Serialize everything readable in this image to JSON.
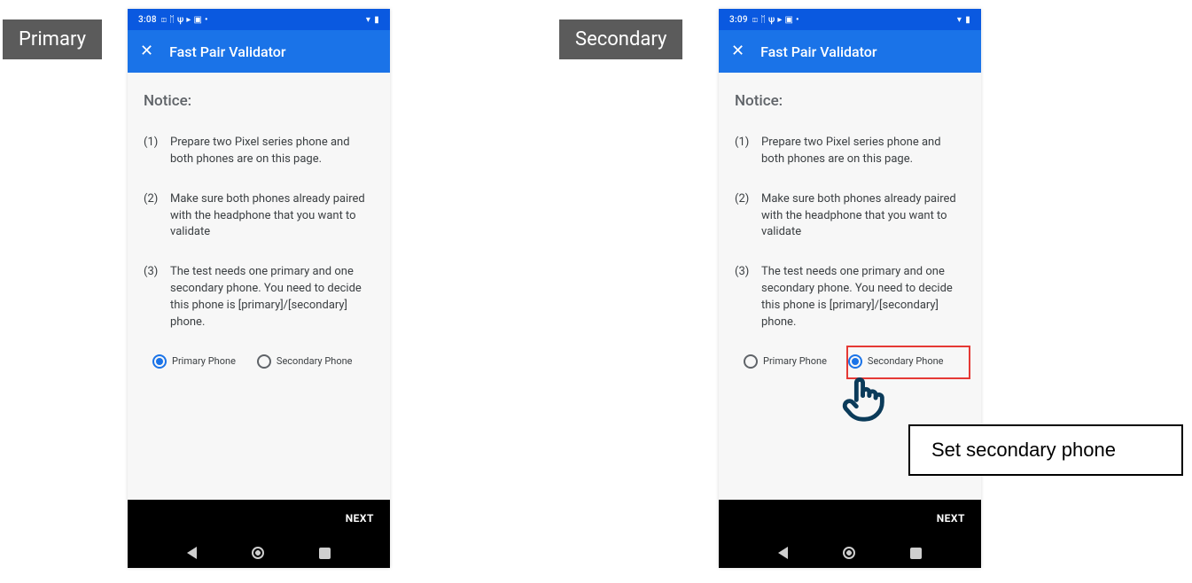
{
  "tags": {
    "primary": "Primary",
    "secondary": "Secondary"
  },
  "callout": "Set secondary phone",
  "phones": {
    "p1": {
      "time": "3:08",
      "status_icons": "◫ ᛖ ψ ▸ ▣ •",
      "app_title": "Fast Pair Validator",
      "notice": "Notice:",
      "step1_num": "(1)",
      "step1_txt": "Prepare two Pixel series phone and both phones are on this page.",
      "step2_num": "(2)",
      "step2_txt": "Make sure both phones already paired with the headphone that you want to validate",
      "step3_num": "(3)",
      "step3_txt": "The test needs one primary and one secondary phone. You need to decide this phone is [primary]/[secondary] phone.",
      "radio_primary": "Primary Phone",
      "radio_secondary": "Secondary Phone",
      "next": "NEXT"
    },
    "p2": {
      "time": "3:09",
      "status_icons": "◫ ᛖ ψ ▸ ▣ •",
      "app_title": "Fast Pair Validator",
      "notice": "Notice:",
      "step1_num": "(1)",
      "step1_txt": "Prepare two Pixel series phone and both phones are on this page.",
      "step2_num": "(2)",
      "step2_txt": "Make sure both phones already paired with the headphone that you want to validate",
      "step3_num": "(3)",
      "step3_txt": "The test needs one primary and one secondary phone. You need to decide this phone is [primary]/[secondary] phone.",
      "radio_primary": "Primary Phone",
      "radio_secondary": "Secondary Phone",
      "next": "NEXT"
    }
  }
}
